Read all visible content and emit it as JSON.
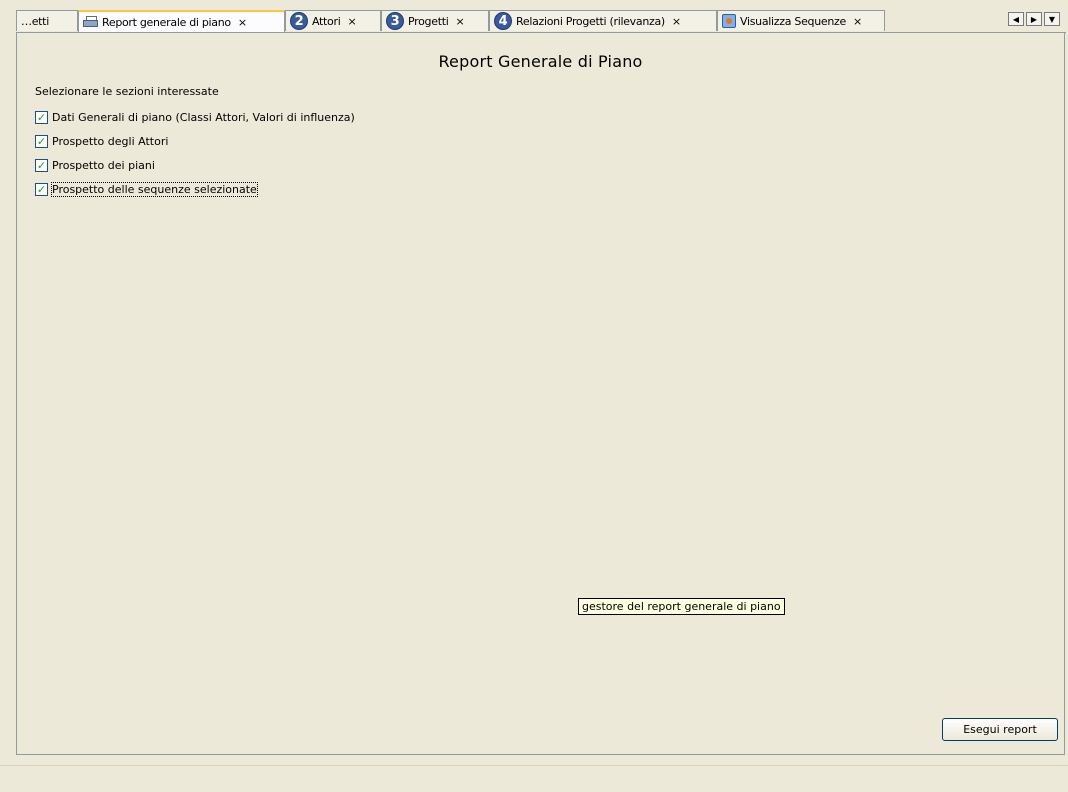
{
  "tabs": [
    {
      "label": "…etti",
      "icon": "none",
      "active": false
    },
    {
      "label": "Report generale di piano",
      "icon": "printer-icon",
      "active": true,
      "closable": true
    },
    {
      "label": "Attori",
      "icon": "number-2-icon",
      "number": "2",
      "closable": true
    },
    {
      "label": "Progetti",
      "icon": "number-3-icon",
      "number": "3",
      "closable": true
    },
    {
      "label": "Relazioni Progetti (rilevanza)",
      "icon": "number-4-icon",
      "number": "4",
      "closable": true
    },
    {
      "label": "Visualizza Sequenze",
      "icon": "sequence-icon",
      "closable": true
    }
  ],
  "close_glyph": "×",
  "page": {
    "title": "Report Generale di Piano",
    "subtitle": "Selezionare le sezioni interessate",
    "options": [
      {
        "label": "Dati Generali di piano (Classi Attori, Valori di influenza)",
        "checked": true
      },
      {
        "label": "Prospetto degli Attori",
        "checked": true
      },
      {
        "label": "Prospetto dei piani",
        "checked": true
      },
      {
        "label": "Prospetto delle sequenze selezionate",
        "checked": true,
        "focused": true
      }
    ],
    "tooltip": "gestore del report generale di piano",
    "run_button": "Esegui report"
  },
  "colors": {
    "background": "#ece9d8",
    "check": "#21a121",
    "active_tab_accent": "#ffc83c"
  }
}
